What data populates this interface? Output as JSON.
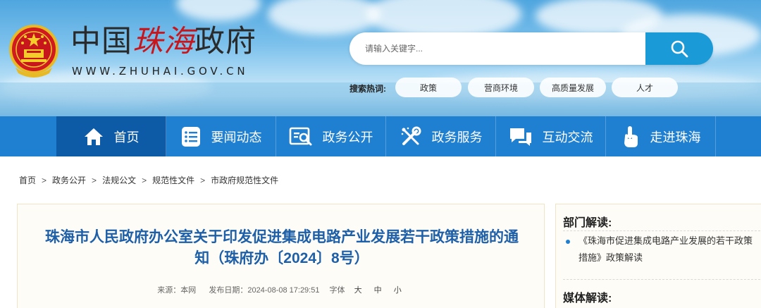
{
  "header": {
    "title_a": "中国",
    "title_b": "珠海",
    "title_c": "政府",
    "url": "WWW.ZHUHAI.GOV.CN",
    "search_placeholder": "请输入关键字...",
    "hot_label": "搜索热词:",
    "hot_tags": [
      "政策",
      "营商环境",
      "高质量发展",
      "人才"
    ]
  },
  "nav": {
    "items": [
      {
        "label": "首页",
        "icon": "home-icon"
      },
      {
        "label": "要闻动态",
        "icon": "news-list-icon"
      },
      {
        "label": "政务公开",
        "icon": "document-search-icon"
      },
      {
        "label": "政务服务",
        "icon": "service-tools-icon"
      },
      {
        "label": "互动交流",
        "icon": "chat-icon"
      },
      {
        "label": "走进珠海",
        "icon": "tap-hand-icon"
      }
    ]
  },
  "breadcrumb": [
    "首页",
    "政务公开",
    "法规公文",
    "规范性文件",
    "市政府规范性文件"
  ],
  "breadcrumb_sep": ">",
  "article": {
    "title_line1": "珠海市人民政府办公室关于印发促进集成电路产业发展若干政策措施的通",
    "title_line2": "知（珠府办〔2024〕8号）",
    "source_label": "来源：本网",
    "date_label": "发布日期：2024-08-08 17:29:51",
    "font_label": "字体",
    "font_large": "大",
    "font_medium": "中",
    "font_small": "小"
  },
  "side": {
    "section1_title": "部门解读:",
    "section1_item": "《珠海市促进集成电路产业发展的若干政策措施》政策解读",
    "section2_title": "媒体解读:"
  },
  "colors": {
    "nav_bg": "#1f7fd1",
    "nav_active": "#0d5aa7",
    "search_btn": "#1a9ad7",
    "title_blue": "#1d5fa8",
    "brand_red": "#c8161d"
  }
}
